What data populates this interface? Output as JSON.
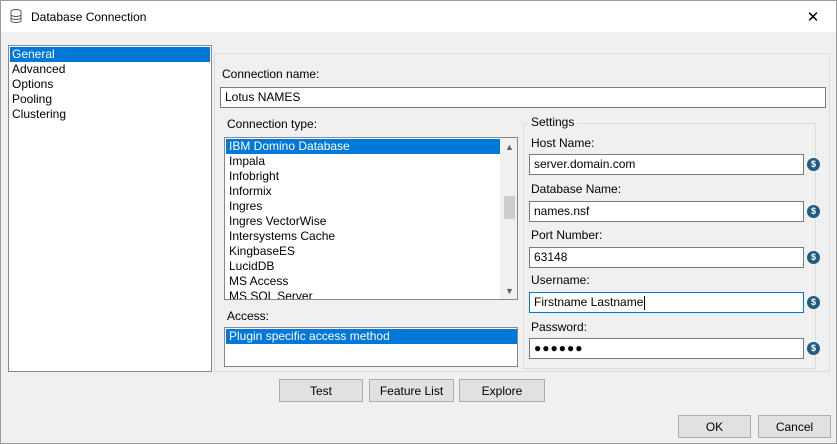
{
  "window": {
    "title": "Database Connection",
    "icon": "database-icon",
    "close_glyph": "✕"
  },
  "nav": {
    "items": [
      {
        "label": "General",
        "selected": true
      },
      {
        "label": "Advanced",
        "selected": false
      },
      {
        "label": "Options",
        "selected": false
      },
      {
        "label": "Pooling",
        "selected": false
      },
      {
        "label": "Clustering",
        "selected": false
      }
    ]
  },
  "general": {
    "connection_name_label": "Connection name:",
    "connection_name_value": "Lotus NAMES",
    "connection_type_label": "Connection type:",
    "connection_types": [
      {
        "label": "IBM Domino Database",
        "selected": true
      },
      {
        "label": "Impala",
        "selected": false
      },
      {
        "label": "Infobright",
        "selected": false
      },
      {
        "label": "Informix",
        "selected": false
      },
      {
        "label": "Ingres",
        "selected": false
      },
      {
        "label": "Ingres VectorWise",
        "selected": false
      },
      {
        "label": "Intersystems Cache",
        "selected": false
      },
      {
        "label": "KingbaseES",
        "selected": false
      },
      {
        "label": "LucidDB",
        "selected": false
      },
      {
        "label": "MS Access",
        "selected": false
      },
      {
        "label": "MS SQL Server",
        "selected": false
      }
    ],
    "access_label": "Access:",
    "access_methods": [
      {
        "label": "Plugin specific access method",
        "selected": true
      }
    ],
    "settings": {
      "title": "Settings",
      "host_label": "Host Name:",
      "host_value": "server.domain.com",
      "db_label": "Database Name:",
      "db_value": "names.nsf",
      "port_label": "Port Number:",
      "port_value": "63148",
      "user_label": "Username:",
      "user_value": "Firstname Lastname",
      "password_label": "Password:",
      "password_value": "●●●●●●",
      "variable_glyph": "$"
    }
  },
  "buttons": {
    "test": "Test",
    "feature_list": "Feature List",
    "explore": "Explore",
    "ok": "OK",
    "cancel": "Cancel"
  },
  "colors": {
    "selection": "#0078d7",
    "variable_icon": "#1d5d82"
  }
}
